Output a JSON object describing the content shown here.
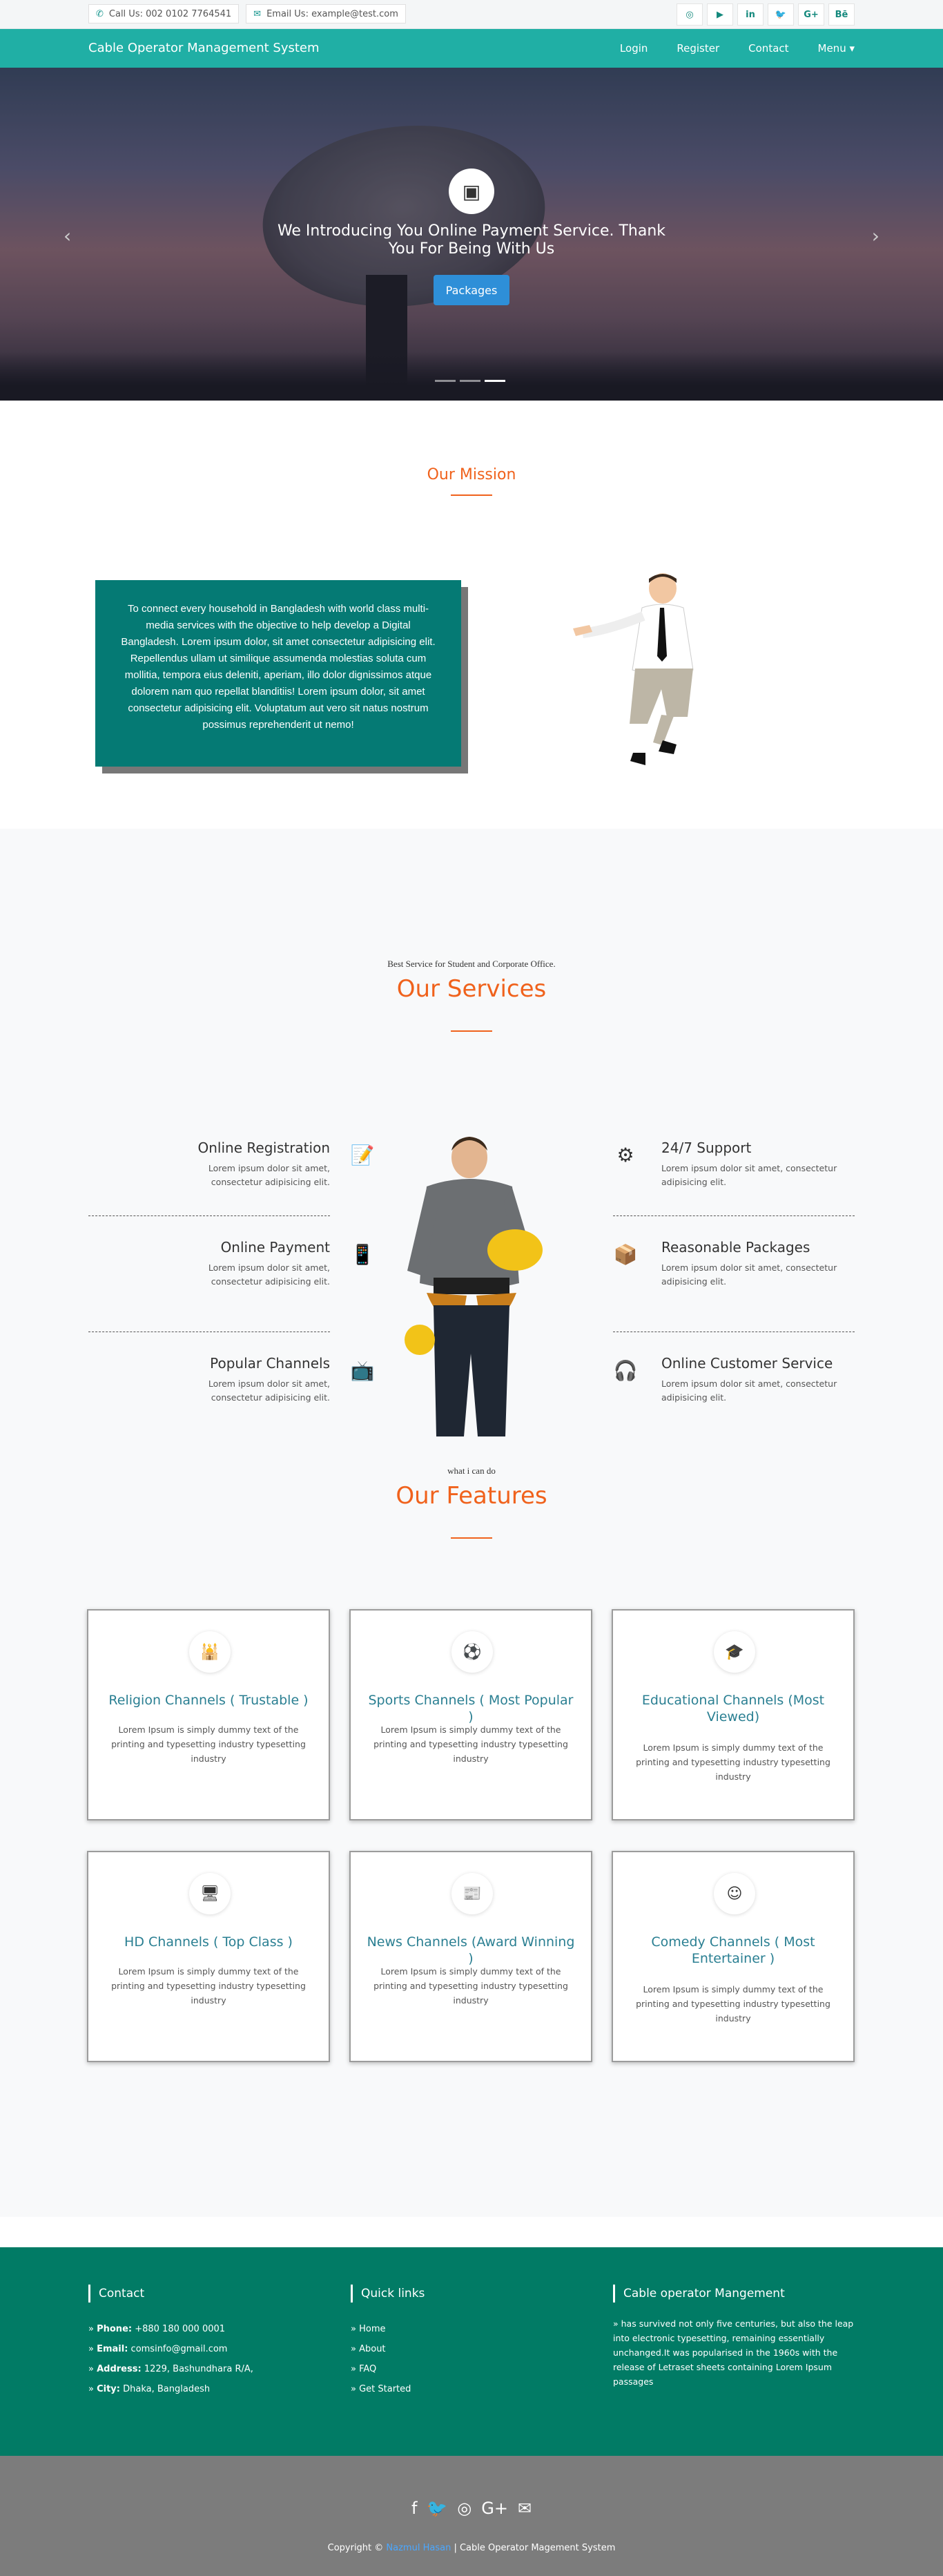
{
  "topbar": {
    "phone": "Call Us: 002 0102 7764541",
    "email": "Email Us: example@test.com",
    "socials": [
      {
        "label": "◎",
        "icon": "instagram-icon"
      },
      {
        "label": "▶",
        "icon": "youtube-icon"
      },
      {
        "label": "in",
        "icon": "linkedin-icon"
      },
      {
        "label": "🐦",
        "icon": "twitter-icon"
      },
      {
        "label": "G+",
        "icon": "google-plus-icon"
      },
      {
        "label": "Bē",
        "icon": "behance-icon"
      }
    ]
  },
  "nav": {
    "brand": "Cable Operator Management System",
    "links": [
      "Login",
      "Register",
      "Contact",
      "Menu ▾"
    ]
  },
  "hero": {
    "headline": "We Introducing You Online Payment Service. Thank You For Being With Us",
    "button": "Packages",
    "prev": "‹",
    "next": "›"
  },
  "mission": {
    "title": "Our Mission",
    "text": "To connect every household in Bangladesh with world class multi-media services with the objective to help develop a Digital Bangladesh. Lorem ipsum dolor, sit amet consectetur adipisicing elit. Repellendus ullam ut similique assumenda molestias soluta cum mollitia, tempora eius deleniti, aperiam, illo dolor dignissimos atque dolorem nam quo repellat blanditiis! Lorem ipsum dolor, sit amet consectetur adipisicing elit. Voluptatum aut vero sit natus nostrum possimus reprehenderit ut nemo!"
  },
  "services": {
    "kicker": "Best Service for Student and Corporate Office.",
    "title": "Our Services",
    "left": [
      {
        "title": "Online Registration",
        "desc": "Lorem ipsum dolor sit amet, consectetur adipisicing elit.",
        "icon": "📝",
        "icon_name": "registration-icon"
      },
      {
        "title": "Online Payment",
        "desc": "Lorem ipsum dolor sit amet, consectetur adipisicing elit.",
        "icon": "📱",
        "icon_name": "payment-icon"
      },
      {
        "title": "Popular Channels",
        "desc": "Lorem ipsum dolor sit amet, consectetur adipisicing elit.",
        "icon": "📺",
        "icon_name": "tv-icon"
      }
    ],
    "right": [
      {
        "title": "24/7 Support",
        "desc": "Lorem ipsum dolor sit amet, consectetur adipisicing elit.",
        "icon": "⚙",
        "icon_name": "support-icon"
      },
      {
        "title": "Reasonable Packages",
        "desc": "Lorem ipsum dolor sit amet, consectetur adipisicing elit.",
        "icon": "📦",
        "icon_name": "package-icon"
      },
      {
        "title": "Online Customer Service",
        "desc": "Lorem ipsum dolor sit amet, consectetur adipisicing elit.",
        "icon": "🎧",
        "icon_name": "customer-service-icon"
      }
    ]
  },
  "features": {
    "kicker": "what i can do",
    "title": "Our Features",
    "cards": [
      {
        "title": "Religion Channels ( Trustable )",
        "desc": "Lorem Ipsum is simply dummy text of the printing and typesetting industry typesetting industry",
        "icon": "🕌",
        "icon_name": "mosque-icon"
      },
      {
        "title": "Sports Channels ( Most Popular )",
        "desc": "Lorem Ipsum is simply dummy text of the printing and typesetting industry typesetting industry",
        "icon": "⚽",
        "icon_name": "football-icon"
      },
      {
        "title": "Educational Channels (Most Viewed)",
        "desc": "Lorem Ipsum is simply dummy text of the printing and typesetting industry typesetting industry",
        "icon": "🎓",
        "icon_name": "education-icon"
      },
      {
        "title": "HD Channels ( Top Class )",
        "desc": "Lorem Ipsum is simply dummy text of the printing and typesetting industry typesetting industry",
        "icon": "🖥",
        "icon_name": "monitor-icon"
      },
      {
        "title": "News Channels (Award Winning )",
        "desc": "Lorem Ipsum is simply dummy text of the printing and typesetting industry typesetting industry",
        "icon": "📰",
        "icon_name": "newspaper-icon"
      },
      {
        "title": "Comedy Channels ( Most Entertainer )",
        "desc": "Lorem Ipsum is simply dummy text of the printing and typesetting industry typesetting industry",
        "icon": "☺",
        "icon_name": "smile-icon"
      }
    ]
  },
  "footer": {
    "contact": {
      "title": "Contact",
      "phone_label": "Phone:",
      "phone": "+880 180 000 0001",
      "email_label": "Email:",
      "email": "comsinfo@gmail.com",
      "address_label": "Address:",
      "address": "1229, Bashundhara R/A,",
      "city_label": "City:",
      "city": "Dhaka, Bangladesh"
    },
    "quick": {
      "title": "Quick links",
      "links": [
        "Home",
        "About",
        "FAQ",
        "Get Started"
      ]
    },
    "about": {
      "title": "Cable operator Mangement",
      "text": "has survived not only five centuries, but also the leap into electronic typesetting, remaining essentially unchanged.It was popularised in the 1960s with the release of Letraset sheets containing Lorem Ipsum passages"
    },
    "bottom": {
      "icons": [
        {
          "label": "f",
          "name": "facebook-icon"
        },
        {
          "label": "🐦",
          "name": "twitter-icon"
        },
        {
          "label": "◎",
          "name": "instagram-icon"
        },
        {
          "label": "G+",
          "name": "google-plus-icon"
        },
        {
          "label": "✉",
          "name": "mail-icon"
        }
      ],
      "copy_prefix": "Copyright ©",
      "copy_link": "Nazmul Hasan",
      "copy_suffix": "| Cable Operator Magement System"
    }
  },
  "colors": {
    "teal": "#20afa5",
    "accent": "#f0621c",
    "footer": "#017b65",
    "card": "#057a74"
  }
}
